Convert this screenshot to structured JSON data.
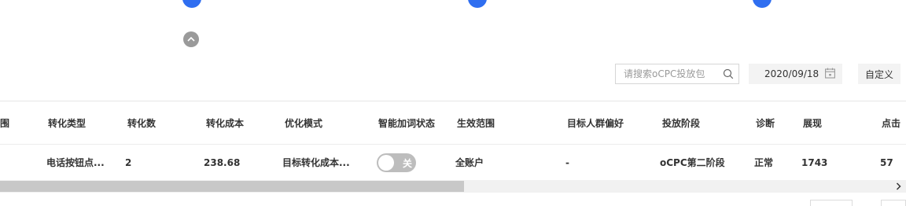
{
  "toolbar": {
    "search_placeholder": "请搜索oCPC投放包",
    "date_value": "2020/09/18",
    "custom_label": "自定义"
  },
  "table": {
    "headers": [
      "围",
      "转化类型",
      "转化数",
      "转化成本",
      "优化模式",
      "智能加词状态",
      "生效范围",
      "目标人群偏好",
      "投放阶段",
      "诊断",
      "展现",
      "点击"
    ],
    "row": {
      "conversion_type": "电话按钮点...",
      "conversions": "2",
      "conversion_cost": "238.68",
      "optimize_mode": "目标转化成本...",
      "smart_keyword_toggle": "关",
      "effective_scope": "全账户",
      "target_audience": "-",
      "delivery_stage": "oCPC第二阶段",
      "diagnosis": "正常",
      "impressions": "1743",
      "clicks": "57"
    }
  },
  "scrollbar": {
    "position_fraction": 0.0,
    "thumb_fraction": 0.51
  },
  "colors": {
    "accent": "#2f6ef0",
    "toggle_off": "#bdbdbd"
  },
  "icons": [
    "step-dot",
    "collapse-up-icon",
    "search-icon",
    "calendar-icon",
    "chevron-right-icon"
  ]
}
